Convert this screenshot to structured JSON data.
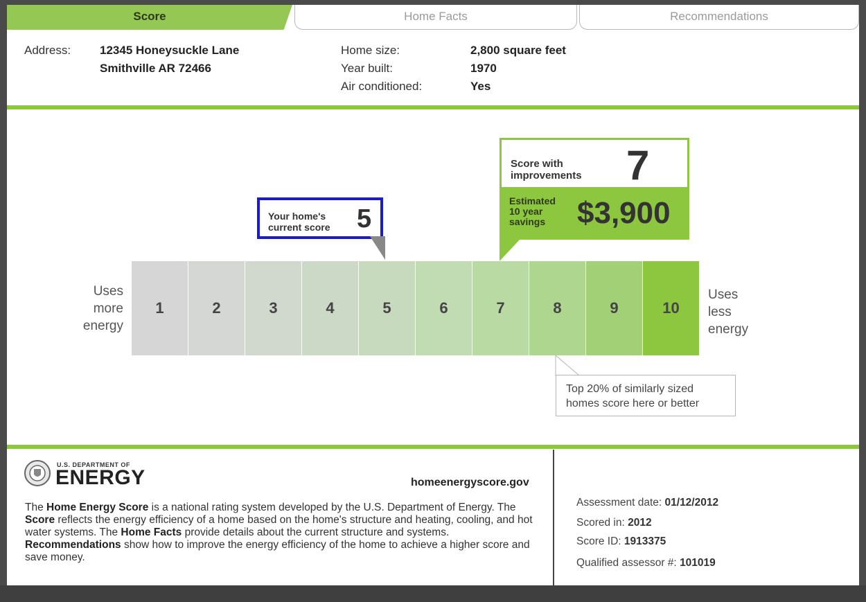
{
  "tabs": {
    "score": "Score",
    "home_facts": "Home Facts",
    "recommendations": "Recommendations"
  },
  "address": {
    "label": "Address:",
    "line1": "12345 Honeysuckle Lane",
    "line2": "Smithville AR 72466"
  },
  "facts": {
    "home_size_label": "Home size:",
    "home_size_value": "2,800 square feet",
    "year_built_label": "Year built:",
    "year_built_value": "1970",
    "ac_label": "Air conditioned:",
    "ac_value": "Yes"
  },
  "scale": {
    "left_label": [
      "Uses",
      "more",
      "energy"
    ],
    "right_label": [
      "Uses",
      "less",
      "energy"
    ],
    "cells": [
      "1",
      "2",
      "3",
      "4",
      "5",
      "6",
      "7",
      "8",
      "9",
      "10"
    ],
    "cell_colors": [
      "#d6d6d6",
      "#d4d7d3",
      "#d1d9cf",
      "#ccd9c7",
      "#c8dabd",
      "#c1dbb2",
      "#b9dba3",
      "#aed68f",
      "#a1d076",
      "#8dc63f"
    ]
  },
  "current": {
    "line1": "Your home's",
    "line2": "current score",
    "score": "5"
  },
  "improvements": {
    "line1": "Score with",
    "line2": "improvements",
    "score": "7",
    "savings_line1": "Estimated",
    "savings_line2": "10 year",
    "savings_line3": "savings",
    "savings": "$3,900"
  },
  "top_note": {
    "line1": "Top 20% of similarly sized",
    "line2": "homes score here or better"
  },
  "footer": {
    "logo_small": "U.S. DEPARTMENT OF",
    "logo_big": "ENERGY",
    "website": "homeenergyscore.gov",
    "desc": {
      "p1": "The ",
      "b1": "Home Energy Score",
      "p2": " is a national rating system developed by the U.S. Department of Energy. The ",
      "b2": "Score",
      "p3": " reflects the energy efficiency of a home based on the home's structure and heating, cooling, and hot water systems.  The ",
      "b3": "Home Facts",
      "p4": " provide details about the current structure and systems. ",
      "b4": "Recommendations",
      "p5": " show how to improve the energy efficiency of the home to achieve a higher score and save money."
    },
    "assessment_label": "Assessment date:",
    "assessment_value": "01/12/2012",
    "scored_label": "Scored in:",
    "scored_value": "2012",
    "id_label": "Score ID:",
    "id_value": "1913375",
    "assessor_label": "Qualified assessor #:",
    "assessor_value": "101019"
  }
}
